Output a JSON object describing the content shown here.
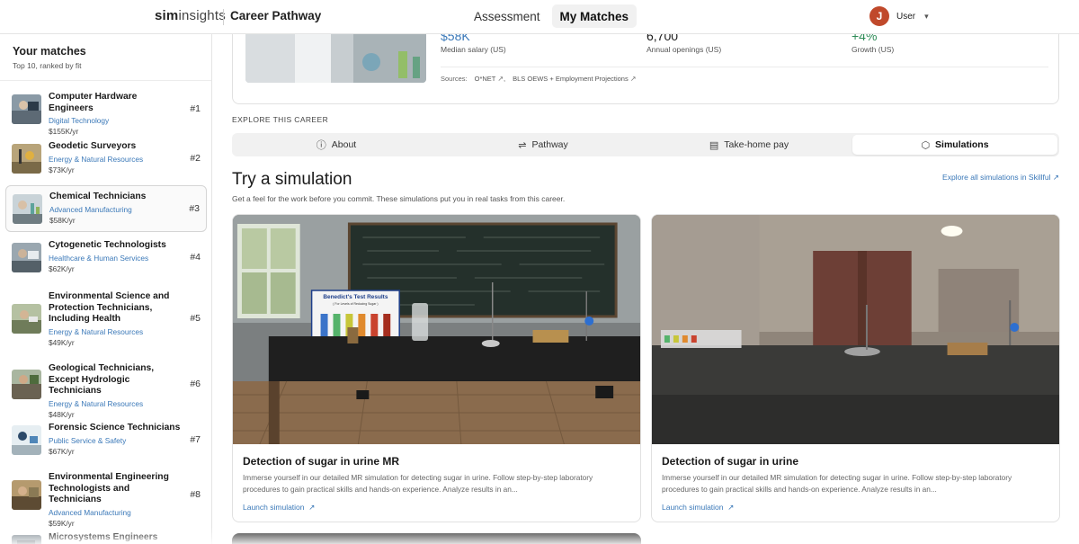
{
  "header": {
    "logo_bold": "sim",
    "logo_light": "insights",
    "app_title": "Career Pathway",
    "nav": [
      {
        "label": "Assessment",
        "active": false
      },
      {
        "label": "My Matches",
        "active": true
      }
    ],
    "user_initial": "J",
    "user_name": "User"
  },
  "sidebar": {
    "title": "Your matches",
    "subtitle": "Top 10, ranked by fit",
    "matches": [
      {
        "title": "Computer Hardware Engineers",
        "category": "Digital Technology",
        "pay": "$155K/yr",
        "rank": "#1"
      },
      {
        "title": "Geodetic Surveyors",
        "category": "Energy & Natural Resources",
        "pay": "$73K/yr",
        "rank": "#2"
      },
      {
        "title": "Chemical Technicians",
        "category": "Advanced Manufacturing",
        "pay": "$58K/yr",
        "rank": "#3"
      },
      {
        "title": "Cytogenetic Technologists",
        "category": "Healthcare & Human Services",
        "pay": "$62K/yr",
        "rank": "#4"
      },
      {
        "title": "Environmental Science and Protection Technicians, Including Health",
        "category": "Energy & Natural Resources",
        "pay": "$49K/yr",
        "rank": "#5"
      },
      {
        "title": "Geological Technicians, Except Hydrologic Technicians",
        "category": "Energy & Natural Resources",
        "pay": "$48K/yr",
        "rank": "#6"
      },
      {
        "title": "Forensic Science Technicians",
        "category": "Public Service & Safety",
        "pay": "$67K/yr",
        "rank": "#7"
      },
      {
        "title": "Environmental Engineering Technologists and Technicians",
        "category": "Advanced Manufacturing",
        "pay": "$59K/yr",
        "rank": "#8"
      },
      {
        "title": "Microsystems Engineers",
        "category": "",
        "pay": "",
        "rank": ""
      }
    ]
  },
  "career": {
    "stats": [
      {
        "value": "$58K",
        "label": "Median salary (US)",
        "color": "#3a78b8"
      },
      {
        "value": "6,700",
        "label": "Annual openings (US)",
        "color": "#1a1a1a"
      },
      {
        "value": "+4%",
        "label": "Growth (US)",
        "color": "#2e8b57"
      }
    ],
    "sources_label": "Sources:",
    "source_1": "O*NET",
    "source_sep": ",",
    "source_2": "BLS OEWS + Employment Projections"
  },
  "explore": {
    "label": "EXPLORE THIS CAREER",
    "tabs": [
      {
        "label": "About",
        "icon": "info-icon"
      },
      {
        "label": "Pathway",
        "icon": "pathway-icon"
      },
      {
        "label": "Take-home pay",
        "icon": "wallet-icon"
      },
      {
        "label": "Simulations",
        "icon": "cube-icon"
      }
    ],
    "active_tab": "Simulations"
  },
  "simulations": {
    "title": "Try a simulation",
    "subtitle": "Get a feel for the work before you commit. These simulations put you in real tasks from this career.",
    "explore_all": "Explore all simulations in Skillful",
    "cards": [
      {
        "name": "Detection of sugar in urine MR",
        "desc": "Immerse yourself in our detailed MR simulation for detecting sugar in urine. Follow step-by-step laboratory procedures to gain practical skills and hands-on experience. Analyze results in an...",
        "launch": "Launch simulation",
        "board_title": "Benedict's Test Results",
        "board_sub": "( For Levels of Reducing Sugar )"
      },
      {
        "name": "Detection of sugar in urine",
        "desc": "Immerse yourself in our detailed MR simulation for detecting sugar in urine. Follow step-by-step laboratory procedures to gain practical skills and hands-on experience. Analyze results in an...",
        "launch": "Launch simulation"
      }
    ]
  },
  "colors": {
    "accent": "#3a78b8",
    "growth": "#2e8b57",
    "avatar": "#c0492b"
  }
}
